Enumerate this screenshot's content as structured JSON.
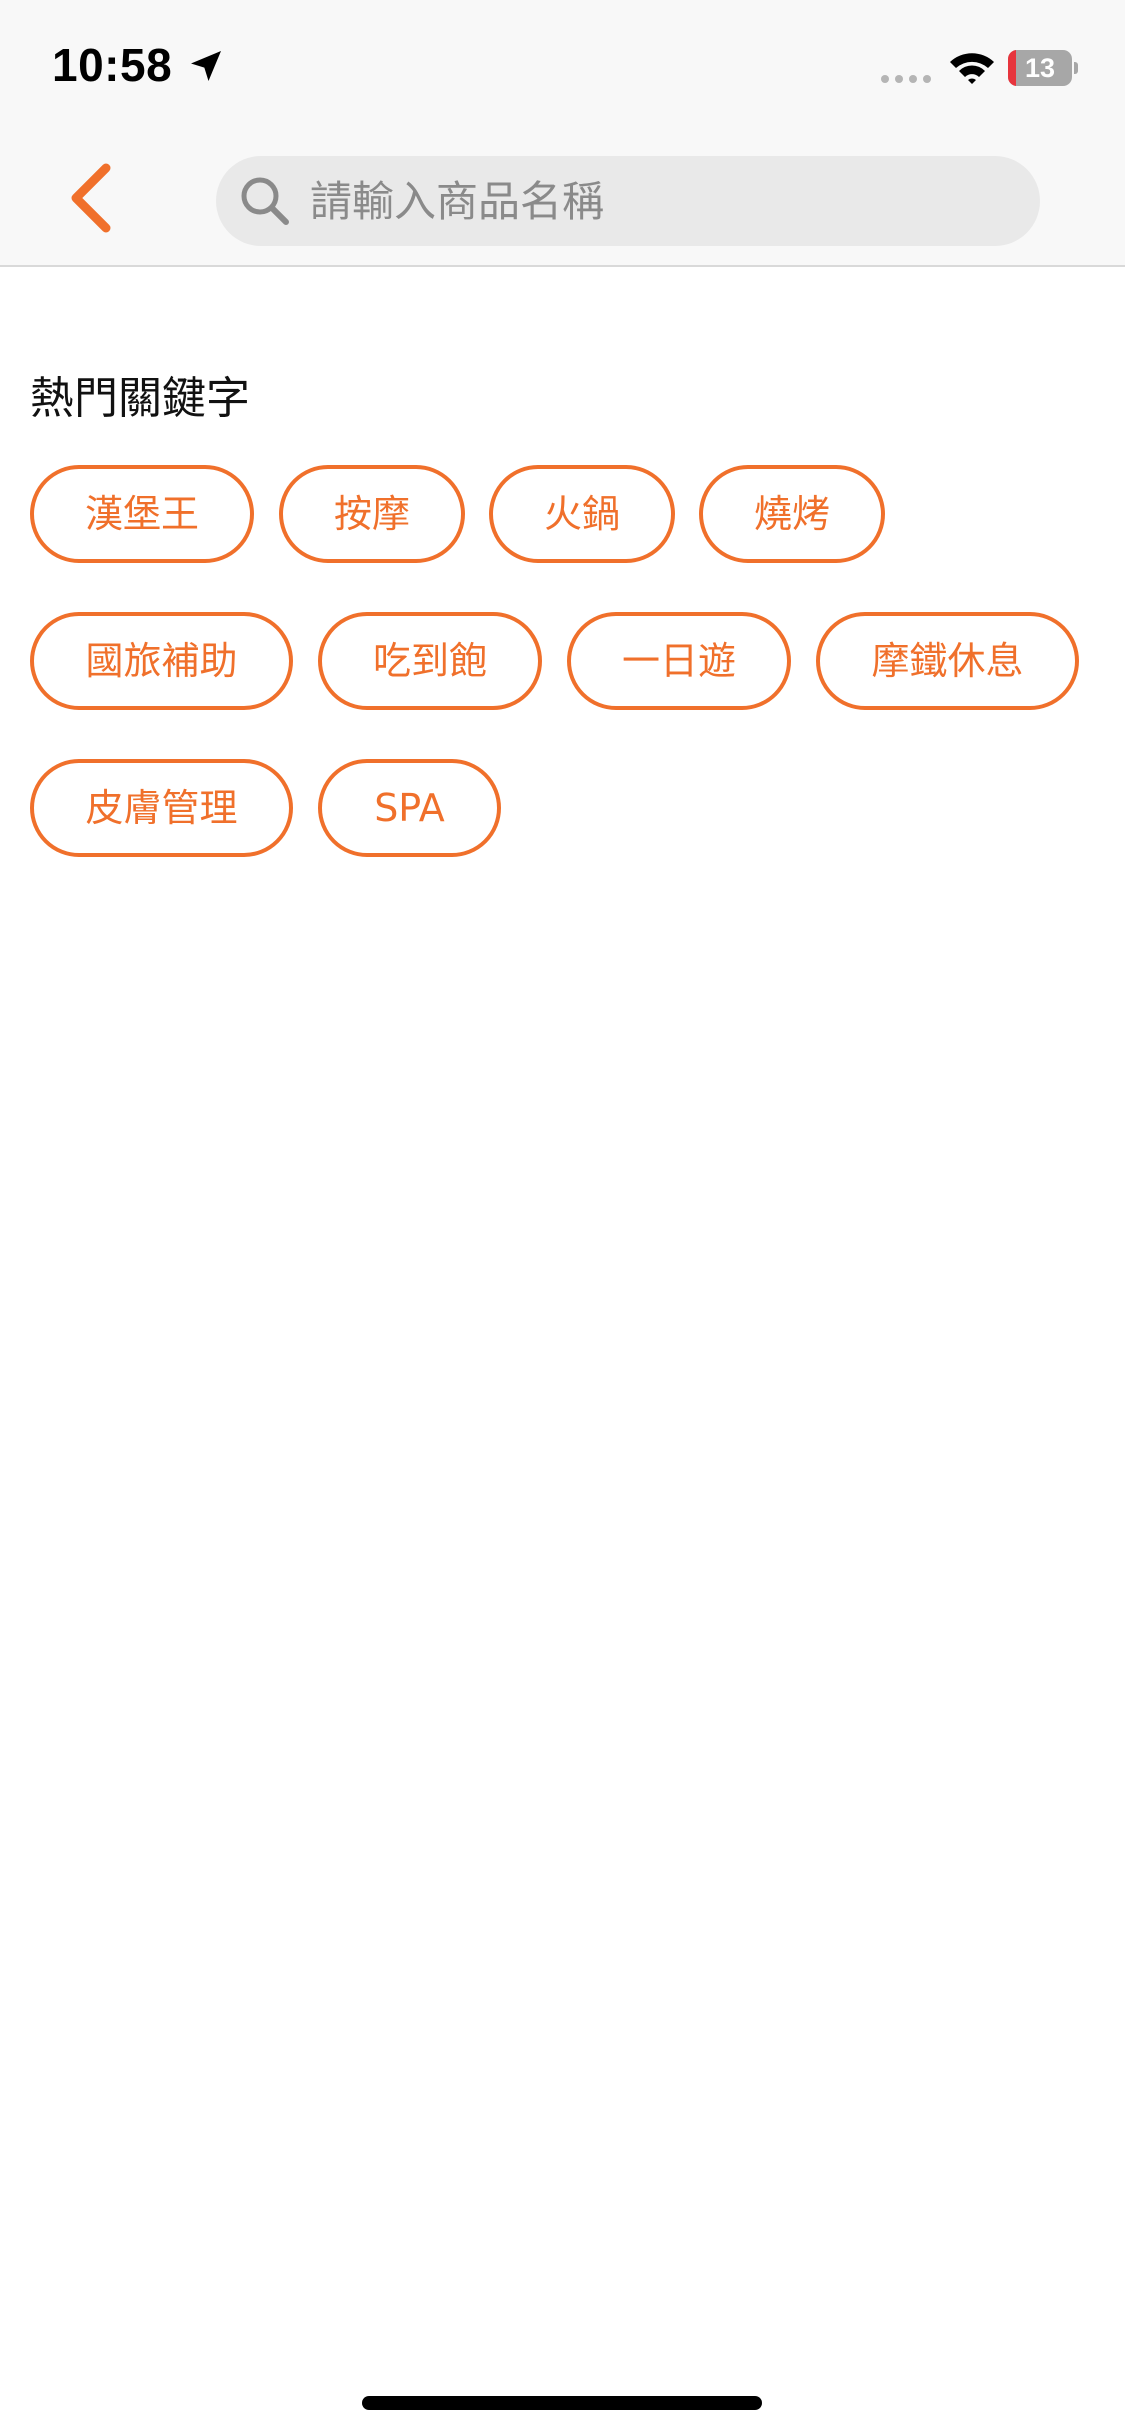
{
  "status_bar": {
    "time": "10:58",
    "battery_level": "13",
    "battery_fraction": 0.13,
    "icons": [
      "location-arrow-icon",
      "signal-dots-icon",
      "wifi-icon",
      "battery-icon"
    ]
  },
  "header": {
    "back_icon": "chevron-left-icon",
    "search": {
      "placeholder": "請輸入商品名稱",
      "value": ""
    }
  },
  "hot_keywords": {
    "title": "熱門關鍵字",
    "tags": [
      "漢堡王",
      "按摩",
      "火鍋",
      "燒烤",
      "國旅補助",
      "吃到飽",
      "一日遊",
      "摩鐵休息",
      "皮膚管理",
      "SPA"
    ]
  },
  "colors": {
    "accent": "#f0702b",
    "header_bg": "#f8f8f8",
    "search_bg": "#e9e9e9",
    "battery_low": "#e7353d"
  }
}
